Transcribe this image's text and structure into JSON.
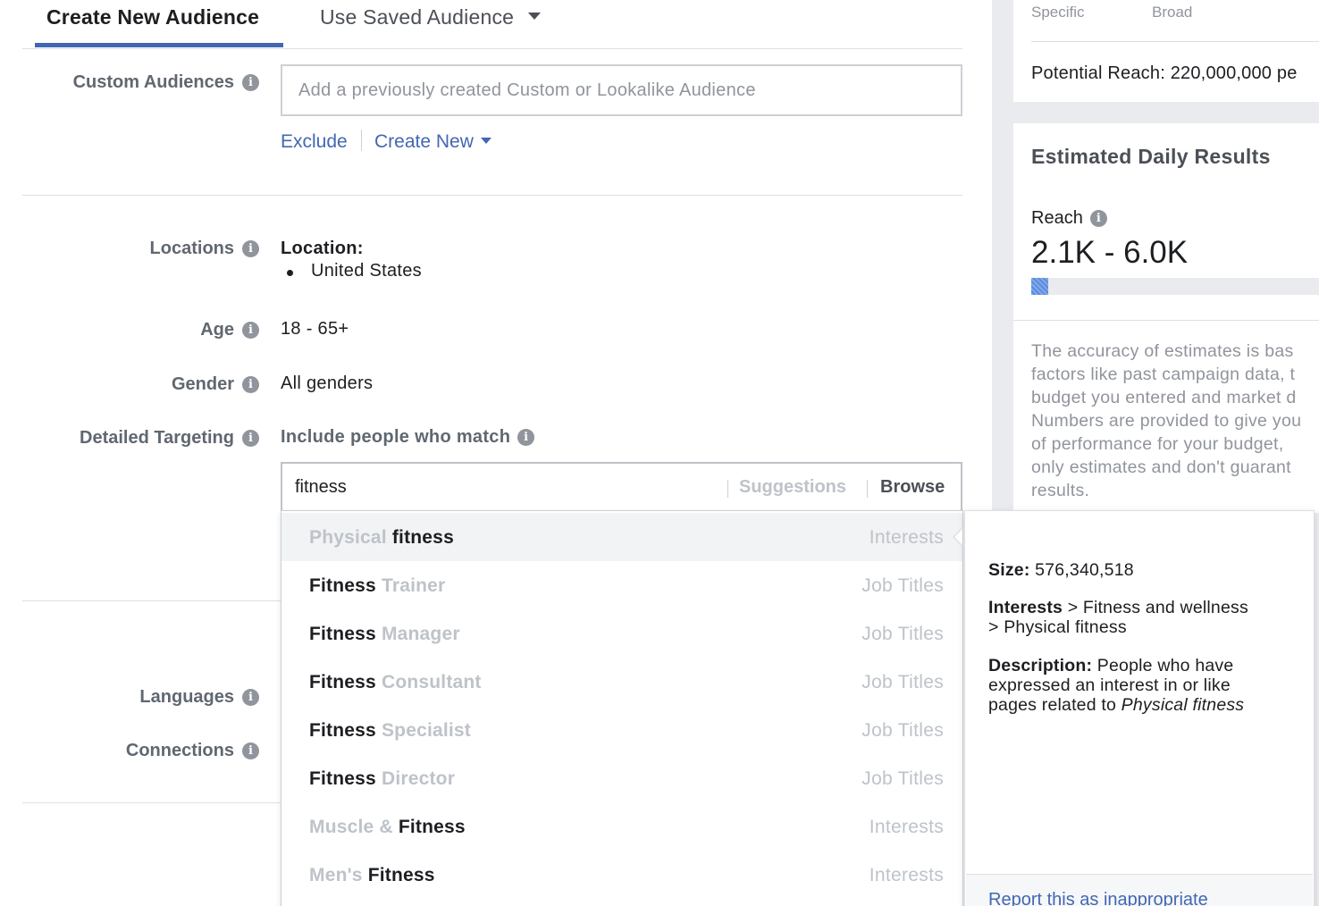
{
  "tabs": {
    "active": "Create New Audience",
    "saved": "Use Saved Audience"
  },
  "custom_audiences": {
    "label": "Custom Audiences",
    "placeholder": "Add a previously created Custom or Lookalike Audience",
    "exclude": "Exclude",
    "create_new": "Create New"
  },
  "locations": {
    "label": "Locations",
    "heading": "Location:",
    "items": [
      "United States"
    ]
  },
  "age": {
    "label": "Age",
    "value": "18 - 65+"
  },
  "gender": {
    "label": "Gender",
    "value": "All genders"
  },
  "detailed_targeting": {
    "label": "Detailed Targeting",
    "include_label": "Include people who match",
    "search_value": "fitness",
    "suggestions": "Suggestions",
    "browse": "Browse"
  },
  "languages": {
    "label": "Languages"
  },
  "connections": {
    "label": "Connections"
  },
  "dropdown": [
    {
      "muted": "Physical ",
      "strong": "fitness",
      "category": "Interests",
      "highlighted": true
    },
    {
      "strong": "Fitness",
      "muted": " Trainer",
      "category": "Job Titles"
    },
    {
      "strong": "Fitness",
      "muted": " Manager",
      "category": "Job Titles"
    },
    {
      "strong": "Fitness",
      "muted": " Consultant",
      "category": "Job Titles"
    },
    {
      "strong": "Fitness",
      "muted": " Specialist",
      "category": "Job Titles"
    },
    {
      "strong": "Fitness",
      "muted": " Director",
      "category": "Job Titles"
    },
    {
      "muted": "Muscle & ",
      "strong": "Fitness",
      "category": "Interests"
    },
    {
      "muted": "Men's ",
      "strong": "Fitness",
      "category": "Interests"
    }
  ],
  "detail": {
    "size_label": "Size:",
    "size_value": "576,340,518",
    "interests_label": "Interests",
    "interests_path_1": " > Fitness and wellness",
    "interests_path_2": "> Physical fitness",
    "description_label": "Description:",
    "description_1": " People who have",
    "description_2": "expressed an interest in or like",
    "description_3": "pages related to ",
    "description_em": "Physical fitness",
    "report_link": "Report this as inappropriate"
  },
  "audience_panel": {
    "specific": "Specific",
    "broad": "Broad",
    "potential_reach": "Potential Reach: 220,000,000 pe"
  },
  "estimates": {
    "title": "Estimated Daily Results",
    "reach_label": "Reach",
    "reach_value": "2.1K - 6.0K",
    "reach_fill_fraction": 0.06,
    "accuracy_lines": [
      "The accuracy of estimates is bas",
      "factors like past campaign data, t",
      "budget you entered and market d",
      "Numbers are provided to give you",
      "of performance for your budget,",
      "only estimates and don't guarant",
      "results."
    ]
  },
  "colors": {
    "accent": "#4267b2",
    "reach_fill": "#5b8ce0",
    "muted_text": "#bec3c9",
    "label_text": "#606770"
  }
}
